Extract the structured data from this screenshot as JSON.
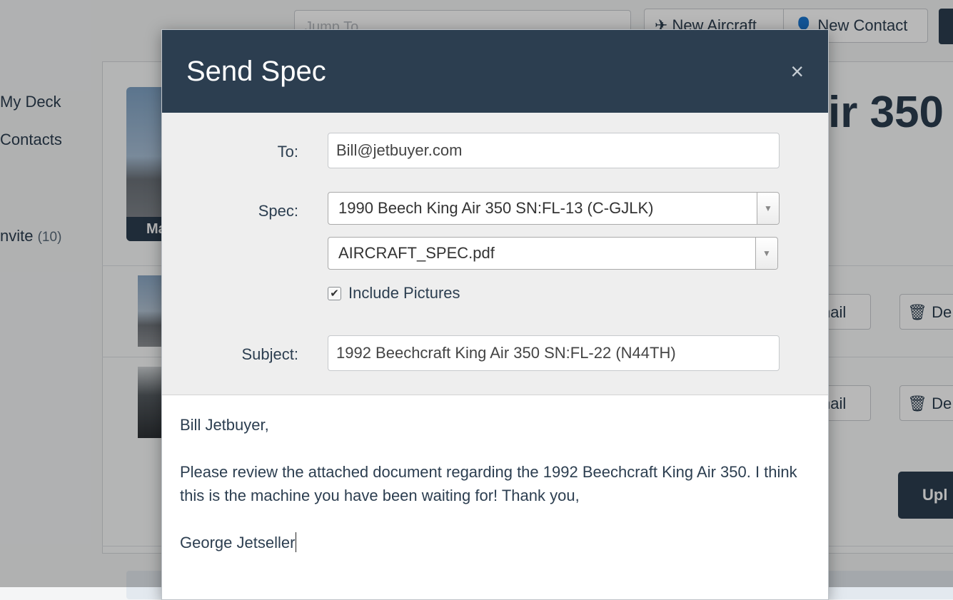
{
  "app": {
    "search_placeholder": "Jump To",
    "new_aircraft_label": "New Aircraft",
    "new_contact_label": "New Contact",
    "sidebar": [
      {
        "label": "My Deck"
      },
      {
        "label": "Contacts"
      },
      {
        "label": "nvite",
        "count": "(10)"
      }
    ],
    "listing_title": "ir 350",
    "thumb_caption": "Ma",
    "row_email_label": "nail",
    "row_delete_label": "De",
    "upload_label": "Upl"
  },
  "modal": {
    "title": "Send Spec",
    "close_label": "×",
    "to_label": "To:",
    "to_value": "Bill@jetbuyer.com",
    "spec_label": "Spec:",
    "spec_selected": "1990 Beech King Air 350 SN:FL-13 (C-GJLK)",
    "file_selected": "AIRCRAFT_SPEC.pdf",
    "include_pictures_label": "Include Pictures",
    "include_pictures_checked": true,
    "subject_label": "Subject:",
    "subject_value": "1992 Beechcraft King Air 350 SN:FL-22 (N44TH)",
    "body": {
      "greeting": "Bill Jetbuyer,",
      "message": "Please review the attached document regarding the 1992 Beechcraft King Air 350. I think this is the machine you have been waiting for! Thank you,",
      "signature": "George Jetseller"
    }
  },
  "colors": {
    "header_bg": "#2c3e50",
    "form_bg": "#eeeeee",
    "text": "#2c3e50"
  }
}
